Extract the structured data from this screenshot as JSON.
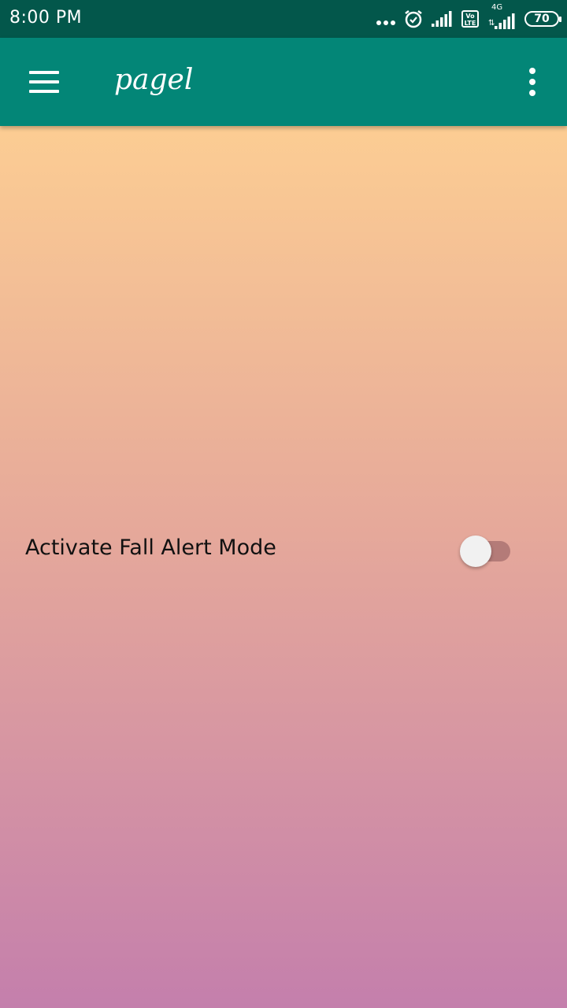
{
  "status_bar": {
    "time": "8:00 PM",
    "network_label": "4G",
    "volte_label": "Vo LTE",
    "battery": "70",
    "icons": [
      "more-dots-icon",
      "alarm-icon",
      "signal-icon",
      "volte-icon",
      "signal-4g-icon",
      "battery-icon"
    ]
  },
  "app_bar": {
    "title": "pagel",
    "menu_icon": "hamburger-menu-icon",
    "overflow_icon": "more-vert-icon",
    "color": "#038677"
  },
  "settings": {
    "fall_alert": {
      "label": "Activate Fall Alert Mode",
      "enabled": false
    }
  },
  "colors": {
    "status_bar": "#03574b",
    "gradient_top": "#fccd93",
    "gradient_bottom": "#c47fac",
    "toggle_track": "#b47b78",
    "toggle_thumb": "#f1f1f1"
  }
}
